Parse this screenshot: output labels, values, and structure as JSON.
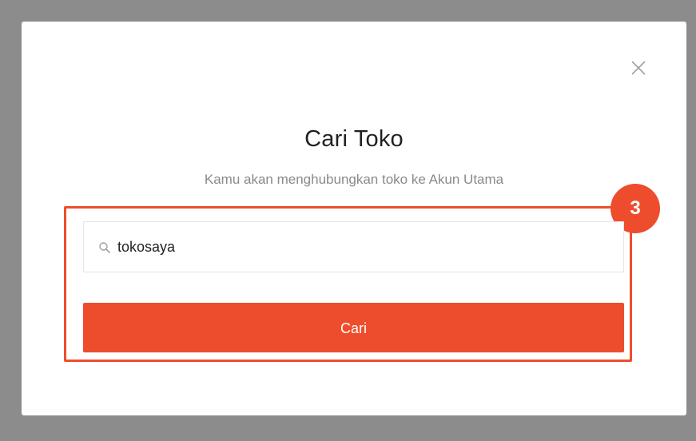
{
  "modal": {
    "title": "Cari Toko",
    "subtitle": "Kamu akan menghubungkan toko ke Akun Utama",
    "close_icon": "close-icon"
  },
  "search": {
    "value": "tokosaya",
    "icon": "search-icon"
  },
  "button": {
    "label": "Cari"
  },
  "annotation": {
    "step_number": "3"
  },
  "colors": {
    "accent": "#ee4d2d",
    "overlay": "#8c8c8c",
    "title": "#212121",
    "subtitle": "#8a8a8a"
  }
}
